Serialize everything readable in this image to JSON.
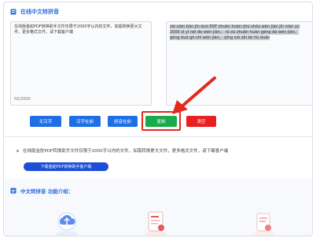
{
  "header": {
    "title": "在线中文转拼音"
  },
  "input_panel": {
    "text": "在线版金舵PDF转换助手文件仅限于2000字以内的文件，如需转换更大文件，更多格式文件，请下载客户端",
    "count": "50/2000"
  },
  "output_panel": {
    "text": "zài xiàn bǎn jīn duò PDF zhuǎn huàn zhù shǒu wén jiàn jǐn xiàn yú 2000 zì yǐ nèi de wén jiàn， rú xū zhuǎn huàn gèng dà wén jiàn， gèng duō gé shì wén jiàn， qǐng xià zǎi kè hù duān"
  },
  "buttons": {
    "no_tone": "无汉字",
    "hanzi_above": "汉字在前",
    "pinyin_above": "拼音在前",
    "copy": "复制",
    "clear": "清空"
  },
  "notice": {
    "text": "在线版金舵PDF转换助手文件仅限于2000字以内的文件，如需转换更大文件，更多格式文件，请下载客户端",
    "download_label": "下载金舵PDF转换助手客户端"
  },
  "intro": {
    "title": "中文转拼音 功能介绍："
  },
  "features": [
    "feature-1",
    "feature-2",
    "feature-3"
  ],
  "colors": {
    "accent": "#2f6fe0",
    "primary_button": "#1e6fe6",
    "copy_button": "#1aaa4b",
    "clear_button": "#e82020",
    "highlight_arrow": "#e22a1e",
    "download_button": "#1d4fd6"
  },
  "icons": {
    "header": "document-icon",
    "notice": "bullet-dot-icon",
    "intro": "info-doc-icon",
    "arrow": "pointer-arrow-icon"
  }
}
